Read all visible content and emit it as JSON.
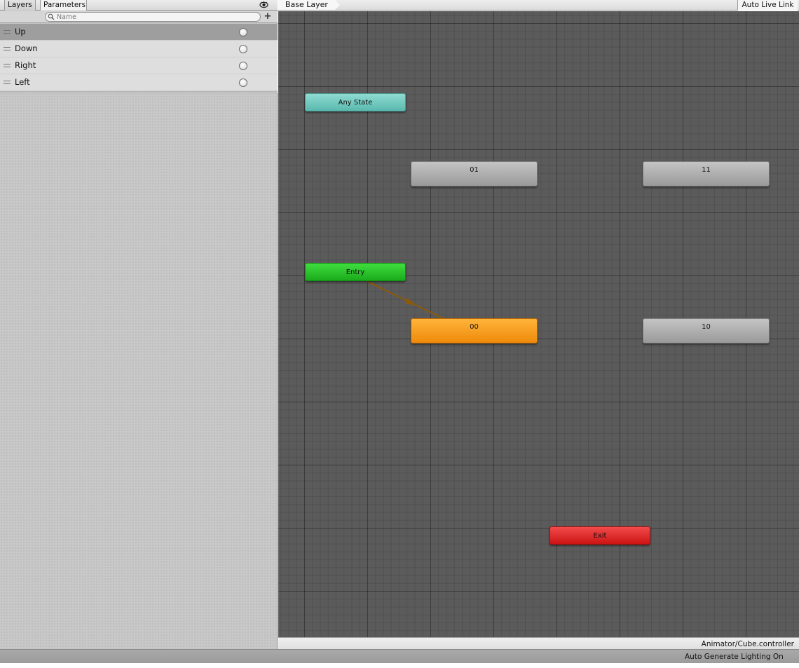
{
  "left_panel": {
    "tabs": [
      {
        "label": "Layers",
        "active": false
      },
      {
        "label": "Parameters",
        "active": true
      }
    ],
    "search": {
      "placeholder": "Name",
      "value": ""
    },
    "add_button": "+",
    "parameters": [
      {
        "name": "Up",
        "selected": true
      },
      {
        "name": "Down",
        "selected": false
      },
      {
        "name": "Right",
        "selected": false
      },
      {
        "name": "Left",
        "selected": false
      }
    ]
  },
  "graph": {
    "breadcrumb": "Base Layer",
    "auto_live_link": "Auto Live Link",
    "nodes": {
      "any_state": "Any State",
      "entry": "Entry",
      "exit": "Exit",
      "state_01": "01",
      "state_11": "11",
      "state_00": "00",
      "state_10": "10"
    },
    "colors": {
      "any_state": "#6cc7bc",
      "entry": "#26c426",
      "exit": "#e02020",
      "default_state": "#f5980f",
      "state": "#a8a8a8",
      "transition": "#8b5a0a"
    }
  },
  "footer": {
    "controller_path": "Animator/Cube.controller",
    "status": "Auto Generate Lighting On"
  }
}
